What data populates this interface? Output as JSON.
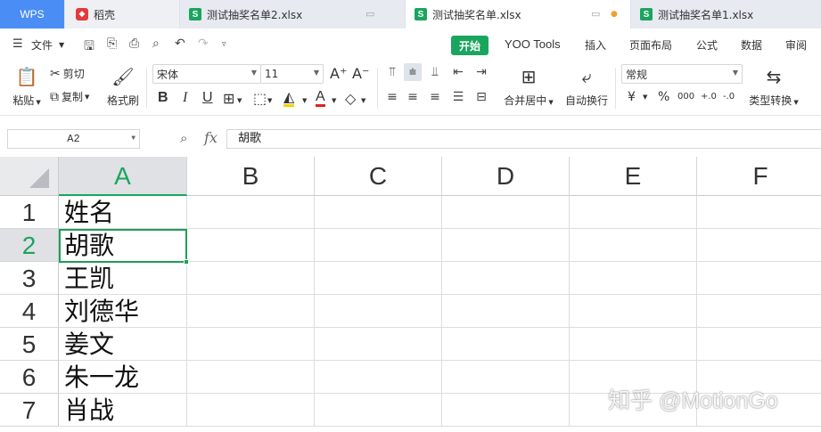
{
  "tabs": {
    "wps": "WPS",
    "daoke": "稻壳",
    "file2": "测试抽奖名单2.xlsx",
    "main": "测试抽奖名单.xlsx",
    "file1": "测试抽奖名单1.xlsx",
    "s_icon": "S"
  },
  "menu": {
    "file": "文件",
    "start": "开始",
    "yoo_tools": "YOO Tools",
    "insert": "插入",
    "page_layout": "页面布局",
    "formula": "公式",
    "data": "数据",
    "review": "审阅"
  },
  "ribbon": {
    "paste": "粘贴",
    "cut": "剪切",
    "copy": "复制",
    "format_painter": "格式刷",
    "font_name": "宋体",
    "font_size": "11",
    "merge_center": "合并居中",
    "wrap_text": "自动换行",
    "number_format": "常规",
    "type_convert": "类型转换",
    "bold": "B",
    "italic": "I",
    "underline": "U",
    "font_grow": "A⁺",
    "font_shrink": "A⁻",
    "font_color_glyph": "A",
    "currency": "¥",
    "percent": "%",
    "thousands": "000",
    "dec_inc": "+.0",
    "dec_dec": "-.0"
  },
  "formula_bar": {
    "name_box": "A2",
    "fx": "fx",
    "content": "胡歌"
  },
  "grid": {
    "columns": [
      "A",
      "B",
      "C",
      "D",
      "E",
      "F"
    ],
    "selected_column": "A",
    "rows": [
      "1",
      "2",
      "3",
      "4",
      "5",
      "6",
      "7"
    ],
    "selected_row": "2",
    "column_a_values": [
      "姓名",
      "胡歌",
      "王凯",
      "刘德华",
      "姜文",
      "朱一龙",
      "肖战"
    ]
  },
  "watermark": "知乎 @MotionGo",
  "colors": {
    "accent_green": "#1aa55e",
    "wps_blue": "#4a8ef5",
    "tab_bar": "#dfe3ea"
  }
}
